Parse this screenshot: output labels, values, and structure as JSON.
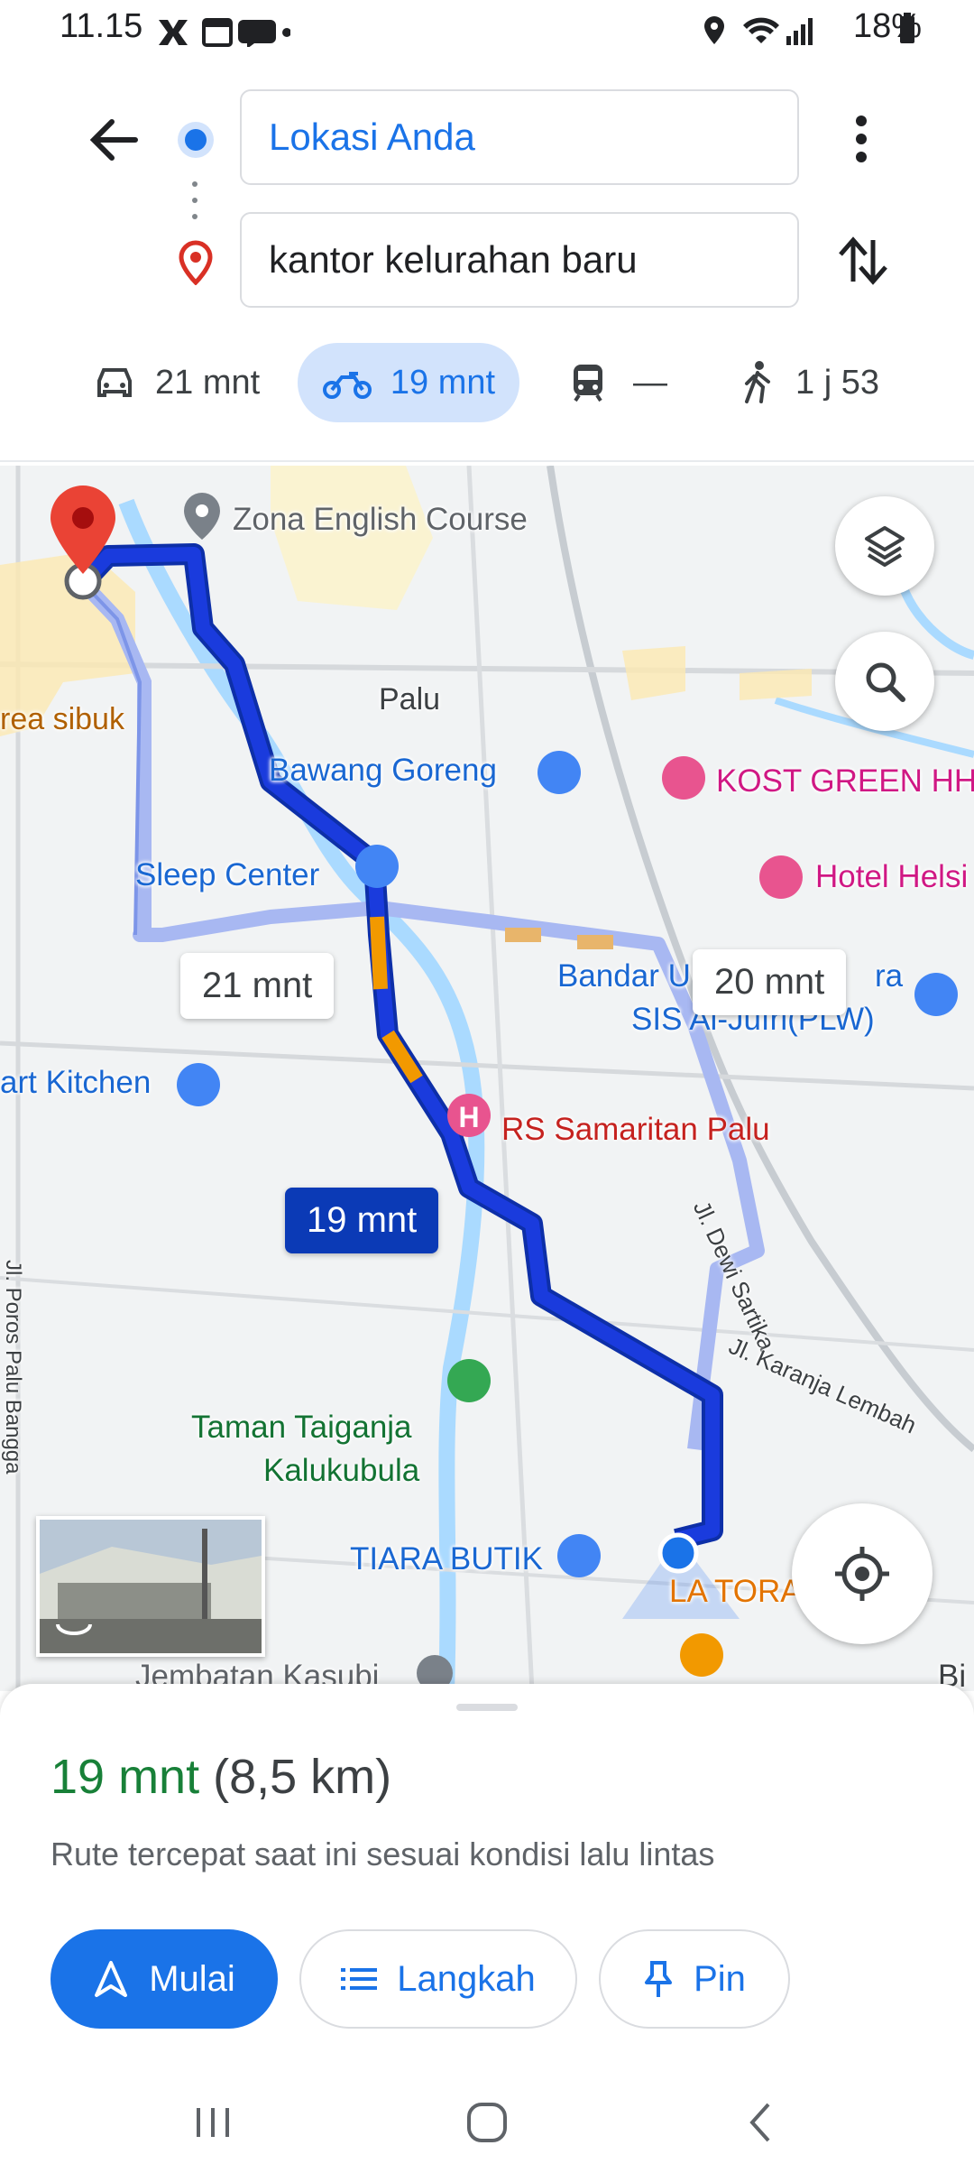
{
  "status": {
    "time": "11.15",
    "battery": "18%"
  },
  "directions": {
    "origin": "Lokasi Anda",
    "destination": "kantor kelurahan baru"
  },
  "modes": [
    {
      "icon": "car-icon",
      "label": "21 mnt"
    },
    {
      "icon": "motorcycle-icon",
      "label": "19 mnt",
      "selected": true
    },
    {
      "icon": "transit-icon",
      "label": "—"
    },
    {
      "icon": "walk-icon",
      "label": "1 j 53"
    }
  ],
  "map": {
    "labels": {
      "zona": "Zona English Course",
      "palu": "Palu",
      "area_sibuk": "rea sibuk",
      "bawang": "Bawang Goreng",
      "kost": "KOST GREEN HH",
      "hotel": "Hotel Helsi",
      "sleep": "Sleep Center",
      "bandar_a": "Bandar U",
      "bandar_b": "ra",
      "sis": "SIS Al-Jufri(PLW)",
      "kitchen": "art Kitchen",
      "rs": "RS Samaritan Palu",
      "dewi": "Jl. Dewi Sartika",
      "karanja": "Jl. Karanja Lembah",
      "poros": "Jl. Poros Palu Bangga",
      "taman1": "Taman Taiganja",
      "taman2": "Kalukubula",
      "tiara": "TIARA BUTIK",
      "latora": "LA TORA",
      "jembatan": "Jembatan Kasubi",
      "bi": "Bi"
    },
    "route_labels": {
      "alt1": "21 mnt",
      "alt2": "20 mnt",
      "main": "19 mnt"
    }
  },
  "sheet": {
    "eta": "19 mnt",
    "distance": "(8,5 km)",
    "subtitle": "Rute tercepat saat ini sesuai kondisi lalu lintas",
    "buttons": {
      "start": "Mulai",
      "steps": "Langkah",
      "pin": "Pin"
    }
  },
  "colors": {
    "accent": "#1a73e8",
    "route_main": "#1a3bdd",
    "route_alt": "#a8b8f2",
    "eta_green": "#188038",
    "pin_red": "#ea4335"
  }
}
